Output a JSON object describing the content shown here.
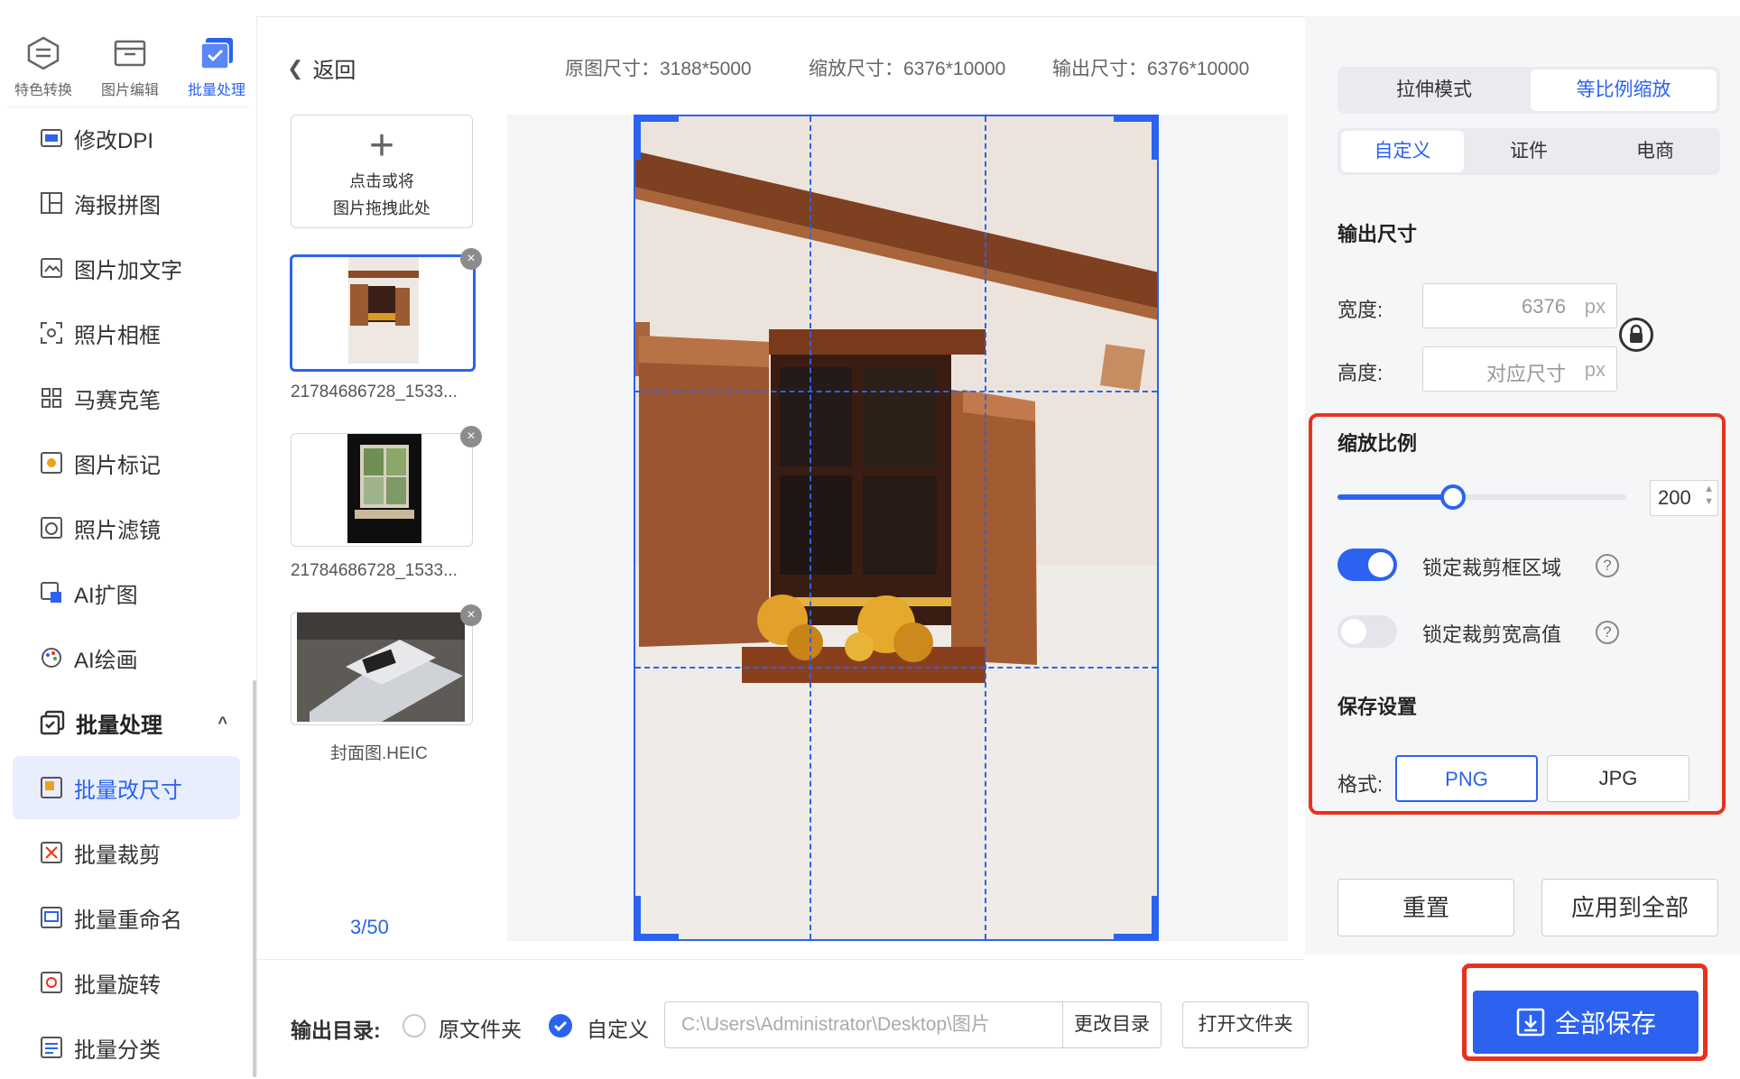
{
  "top_tabs": [
    {
      "label": "特色转换",
      "icon": "convert-icon"
    },
    {
      "label": "图片编辑",
      "icon": "image-edit-icon"
    },
    {
      "label": "批量处理",
      "icon": "batch-icon"
    }
  ],
  "sidebar": {
    "items_a": [
      {
        "label": "修改DPI",
        "icon": "dpi-icon"
      },
      {
        "label": "海报拼图",
        "icon": "collage-icon"
      },
      {
        "label": "图片加文字",
        "icon": "add-text-icon"
      },
      {
        "label": "照片相框",
        "icon": "frame-icon"
      },
      {
        "label": "马赛克笔",
        "icon": "mosaic-icon"
      },
      {
        "label": "图片标记",
        "icon": "mark-icon"
      },
      {
        "label": "照片滤镜",
        "icon": "filter-icon"
      },
      {
        "label": "AI扩图",
        "icon": "ai-expand-icon"
      },
      {
        "label": "AI绘画",
        "icon": "ai-paint-icon"
      }
    ],
    "group": {
      "label": "批量处理",
      "chevron": "^"
    },
    "items_b": [
      {
        "label": "批量改尺寸",
        "icon": "batch-resize-icon"
      },
      {
        "label": "批量裁剪",
        "icon": "batch-crop-icon"
      },
      {
        "label": "批量重命名",
        "icon": "batch-rename-icon"
      },
      {
        "label": "批量旋转",
        "icon": "batch-rotate-icon"
      },
      {
        "label": "批量分类",
        "icon": "batch-classify-icon"
      }
    ]
  },
  "header": {
    "back": "返回",
    "original_size": "原图尺寸：3188*5000",
    "scaled_size": "缩放尺寸：6376*10000",
    "output_size": "输出尺寸：6376*10000"
  },
  "upload": {
    "line1": "点击或将",
    "line2": "图片拖拽此处"
  },
  "thumbs": [
    {
      "name": "21784686728_1533..."
    },
    {
      "name": "21784686728_1533..."
    },
    {
      "name": "封面图.HEIC"
    }
  ],
  "pager": "3/50",
  "right": {
    "mode_tabs": [
      "拉伸模式",
      "等比例缩放"
    ],
    "preset_tabs": [
      "自定义",
      "证件",
      "电商"
    ],
    "output_size_title": "输出尺寸",
    "width_label": "宽度:",
    "width_value": "6376",
    "height_label": "高度:",
    "height_value": "对应尺寸",
    "unit": "px",
    "scale_title": "缩放比例",
    "scale_value": "200",
    "scale_fraction": 0.4,
    "lock_area": {
      "label": "锁定裁剪框区域",
      "on": true
    },
    "lock_wh": {
      "label": "锁定裁剪宽高值",
      "on": false
    },
    "save_title": "保存设置",
    "format_label": "格式:",
    "formats": [
      "PNG",
      "JPG"
    ],
    "reset": "重置",
    "apply_all": "应用到全部",
    "save_all": "全部保存"
  },
  "bottom": {
    "output_dir_label": "输出目录:",
    "opt_original": "原文件夹",
    "opt_custom": "自定义",
    "path": "C:\\Users\\Administrator\\Desktop\\图片",
    "change_dir": "更改目录",
    "open_folder": "打开文件夹"
  },
  "colors": {
    "accent": "#2b63f0",
    "highlight": "#e8321e"
  }
}
